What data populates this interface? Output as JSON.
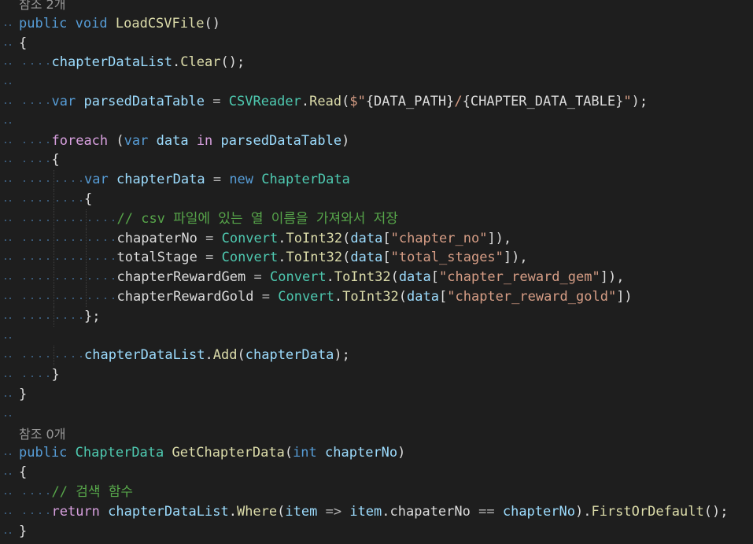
{
  "theme": {
    "background": "#1e1e1e"
  },
  "lines": [
    {
      "kind": "lens",
      "indent": 0,
      "text": "참조 2개"
    },
    {
      "indent": 0,
      "tokens": [
        [
          "k",
          "public"
        ],
        [
          "p",
          " "
        ],
        [
          "k",
          "void"
        ],
        [
          "p",
          " "
        ],
        [
          "m",
          "LoadCSVFile"
        ],
        [
          "p",
          "()"
        ]
      ]
    },
    {
      "indent": 0,
      "tokens": [
        [
          "p",
          "{"
        ]
      ]
    },
    {
      "indent": 1,
      "tokens": [
        [
          "v",
          "chapterDataList"
        ],
        [
          "p",
          "."
        ],
        [
          "m",
          "Clear"
        ],
        [
          "p",
          "();"
        ]
      ]
    },
    {
      "indent": 0,
      "tokens": []
    },
    {
      "indent": 1,
      "tokens": [
        [
          "k",
          "var"
        ],
        [
          "p",
          " "
        ],
        [
          "v",
          "parsedDataTable"
        ],
        [
          "p",
          " "
        ],
        [
          "o",
          "="
        ],
        [
          "p",
          " "
        ],
        [
          "t",
          "CSVReader"
        ],
        [
          "p",
          "."
        ],
        [
          "m",
          "Read"
        ],
        [
          "p",
          "("
        ],
        [
          "s",
          "$\""
        ],
        [
          "p",
          "{DATA_PATH}"
        ],
        [
          "s",
          "/"
        ],
        [
          "p",
          "{CHAPTER_DATA_TABLE}"
        ],
        [
          "s",
          "\""
        ],
        [
          "p",
          ");"
        ]
      ]
    },
    {
      "indent": 0,
      "tokens": []
    },
    {
      "indent": 1,
      "tokens": [
        [
          "kc",
          "foreach"
        ],
        [
          "p",
          " ("
        ],
        [
          "k",
          "var"
        ],
        [
          "p",
          " "
        ],
        [
          "v",
          "data"
        ],
        [
          "p",
          " "
        ],
        [
          "kc",
          "in"
        ],
        [
          "p",
          " "
        ],
        [
          "v",
          "parsedDataTable"
        ],
        [
          "p",
          ")"
        ]
      ]
    },
    {
      "indent": 1,
      "tokens": [
        [
          "p",
          "{"
        ]
      ]
    },
    {
      "indent": 2,
      "tokens": [
        [
          "k",
          "var"
        ],
        [
          "p",
          " "
        ],
        [
          "v",
          "chapterData"
        ],
        [
          "p",
          " "
        ],
        [
          "o",
          "="
        ],
        [
          "p",
          " "
        ],
        [
          "k",
          "new"
        ],
        [
          "p",
          " "
        ],
        [
          "t",
          "ChapterData"
        ]
      ]
    },
    {
      "indent": 2,
      "tokens": [
        [
          "p",
          "{"
        ]
      ]
    },
    {
      "indent": 3,
      "tokens": [
        [
          "c",
          "// csv 파일에 있는 열 이름을 가져와서 저장"
        ]
      ]
    },
    {
      "indent": 3,
      "tokens": [
        [
          "p",
          "chapaterNo "
        ],
        [
          "o",
          "="
        ],
        [
          "p",
          " "
        ],
        [
          "t",
          "Convert"
        ],
        [
          "p",
          "."
        ],
        [
          "m",
          "ToInt32"
        ],
        [
          "p",
          "("
        ],
        [
          "v",
          "data"
        ],
        [
          "p",
          "["
        ],
        [
          "s",
          "\"chapter_no\""
        ],
        [
          "p",
          "]),"
        ]
      ]
    },
    {
      "indent": 3,
      "tokens": [
        [
          "p",
          "totalStage "
        ],
        [
          "o",
          "="
        ],
        [
          "p",
          " "
        ],
        [
          "t",
          "Convert"
        ],
        [
          "p",
          "."
        ],
        [
          "m",
          "ToInt32"
        ],
        [
          "p",
          "("
        ],
        [
          "v",
          "data"
        ],
        [
          "p",
          "["
        ],
        [
          "s",
          "\"total_stages\""
        ],
        [
          "p",
          "]),"
        ]
      ]
    },
    {
      "indent": 3,
      "tokens": [
        [
          "p",
          "chapterRewardGem "
        ],
        [
          "o",
          "="
        ],
        [
          "p",
          " "
        ],
        [
          "t",
          "Convert"
        ],
        [
          "p",
          "."
        ],
        [
          "m",
          "ToInt32"
        ],
        [
          "p",
          "("
        ],
        [
          "v",
          "data"
        ],
        [
          "p",
          "["
        ],
        [
          "s",
          "\"chapter_reward_gem\""
        ],
        [
          "p",
          "]),"
        ]
      ]
    },
    {
      "indent": 3,
      "tokens": [
        [
          "p",
          "chapterRewardGold "
        ],
        [
          "o",
          "="
        ],
        [
          "p",
          " "
        ],
        [
          "t",
          "Convert"
        ],
        [
          "p",
          "."
        ],
        [
          "m",
          "ToInt32"
        ],
        [
          "p",
          "("
        ],
        [
          "v",
          "data"
        ],
        [
          "p",
          "["
        ],
        [
          "s",
          "\"chapter_reward_gold\""
        ],
        [
          "p",
          "])"
        ]
      ]
    },
    {
      "indent": 2,
      "tokens": [
        [
          "p",
          "};"
        ]
      ]
    },
    {
      "indent": 0,
      "tokens": []
    },
    {
      "indent": 2,
      "tokens": [
        [
          "v",
          "chapterDataList"
        ],
        [
          "p",
          "."
        ],
        [
          "m",
          "Add"
        ],
        [
          "p",
          "("
        ],
        [
          "v",
          "chapterData"
        ],
        [
          "p",
          ");"
        ]
      ]
    },
    {
      "indent": 1,
      "tokens": [
        [
          "p",
          "}"
        ]
      ]
    },
    {
      "indent": 0,
      "tokens": [
        [
          "p",
          "}"
        ]
      ]
    },
    {
      "indent": 0,
      "tokens": []
    },
    {
      "kind": "lens",
      "indent": 0,
      "text": "참조 0개"
    },
    {
      "indent": 0,
      "tokens": [
        [
          "k",
          "public"
        ],
        [
          "p",
          " "
        ],
        [
          "t",
          "ChapterData"
        ],
        [
          "p",
          " "
        ],
        [
          "m",
          "GetChapterData"
        ],
        [
          "p",
          "("
        ],
        [
          "k",
          "int"
        ],
        [
          "p",
          " "
        ],
        [
          "v",
          "chapterNo"
        ],
        [
          "p",
          ")"
        ]
      ]
    },
    {
      "indent": 0,
      "tokens": [
        [
          "p",
          "{"
        ]
      ]
    },
    {
      "indent": 1,
      "tokens": [
        [
          "c",
          "// 검색 함수"
        ]
      ]
    },
    {
      "indent": 1,
      "tokens": [
        [
          "kc",
          "return"
        ],
        [
          "p",
          " "
        ],
        [
          "v",
          "chapterDataList"
        ],
        [
          "p",
          "."
        ],
        [
          "m",
          "Where"
        ],
        [
          "p",
          "("
        ],
        [
          "v",
          "item"
        ],
        [
          "p",
          " "
        ],
        [
          "o",
          "=>"
        ],
        [
          "p",
          " "
        ],
        [
          "v",
          "item"
        ],
        [
          "p",
          ".chapaterNo "
        ],
        [
          "o",
          "=="
        ],
        [
          "p",
          " "
        ],
        [
          "v",
          "chapterNo"
        ],
        [
          "p",
          ")."
        ],
        [
          "m",
          "FirstOrDefault"
        ],
        [
          "p",
          "();"
        ]
      ]
    },
    {
      "indent": 0,
      "tokens": [
        [
          "p",
          "}"
        ]
      ]
    }
  ]
}
